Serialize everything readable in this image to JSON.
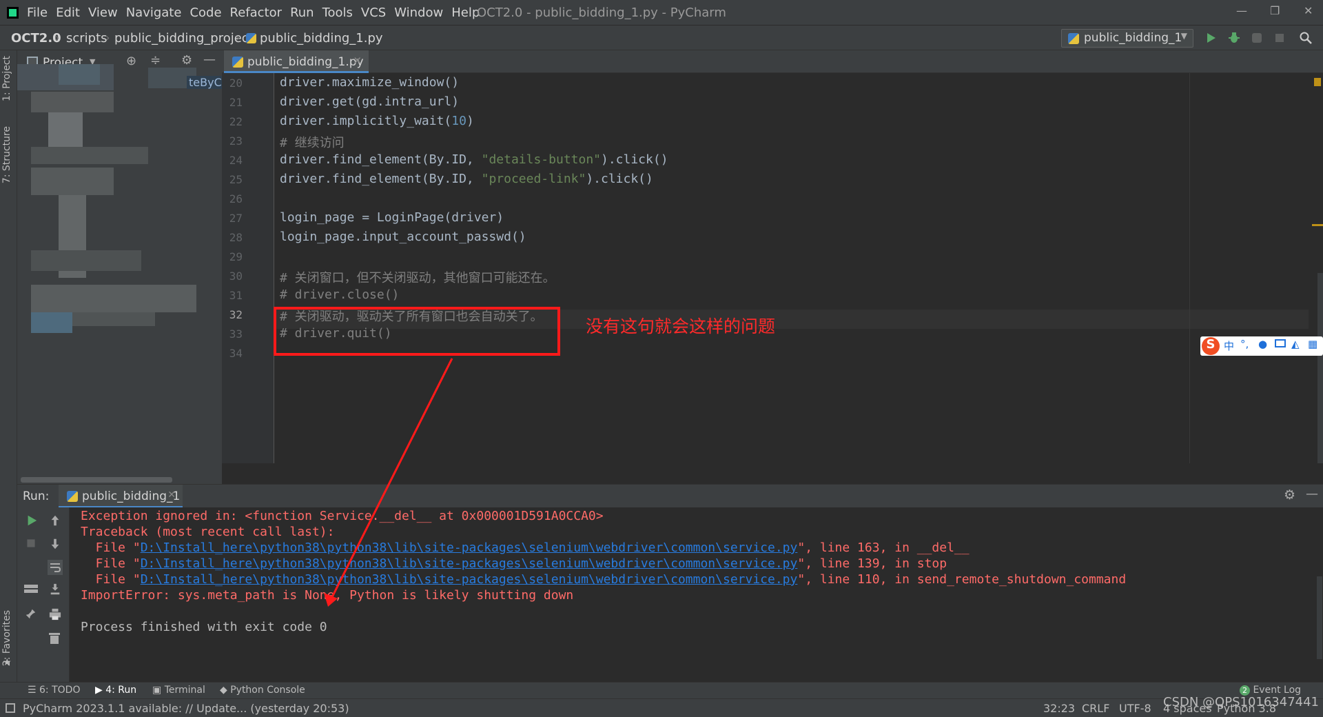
{
  "menu": {
    "items": [
      "File",
      "Edit",
      "View",
      "Navigate",
      "Code",
      "Refactor",
      "Run",
      "Tools",
      "VCS",
      "Window",
      "Help"
    ],
    "window_title": "OCT2.0 - public_bidding_1.py - PyCharm"
  },
  "nav": {
    "breadcrumbs": [
      "OCT2.0",
      "scripts",
      "public_bidding_project",
      "public_bidding_1.py"
    ],
    "run_config": "public_bidding_1"
  },
  "sidebar": {
    "project_label": "Project",
    "structure_label": "7: Structure",
    "project_tab_label": "1: Project",
    "favorites_label": "2: Favorites",
    "partial_text": "teByCl"
  },
  "editor": {
    "tab_label": "public_bidding_1.py",
    "current_line": 32,
    "lines": [
      {
        "n": "20",
        "text": "driver.maximize_window()"
      },
      {
        "n": "21",
        "text": "driver.get(gd.intra_url)"
      },
      {
        "n": "22",
        "pre": "driver.implicitly_wait(",
        "num": "10",
        "post": ")"
      },
      {
        "n": "23",
        "comment": "# 继续访问"
      },
      {
        "n": "24",
        "pre": "driver.find_element(By.ID, ",
        "str": "\"details-button\"",
        "post": ").click()"
      },
      {
        "n": "25",
        "pre": "driver.find_element(By.ID, ",
        "str": "\"proceed-link\"",
        "post": ").click()"
      },
      {
        "n": "26",
        "text": ""
      },
      {
        "n": "27",
        "text": "login_page = LoginPage(driver)"
      },
      {
        "n": "28",
        "text": "login_page.input_account_passwd()"
      },
      {
        "n": "29",
        "text": ""
      },
      {
        "n": "30",
        "comment": "# 关闭窗口，但不关闭驱动，其他窗口可能还在。"
      },
      {
        "n": "31",
        "comment": "# driver.close()"
      },
      {
        "n": "32",
        "comment": "# 关闭驱动，驱动关了所有窗口也会自动关了。"
      },
      {
        "n": "33",
        "comment": "# driver.quit()"
      },
      {
        "n": "34",
        "text": ""
      }
    ]
  },
  "annotation": {
    "note": "没有这句就会这样的问题",
    "color": "#ff1a1a"
  },
  "ime": {
    "logo": "S",
    "mode": "中"
  },
  "run": {
    "label": "Run:",
    "tab_label": "public_bidding_1",
    "output": {
      "l1": "Exception ignored in: <function Service.__del__ at 0x000001D591A0CCA0>",
      "l2": "Traceback (most recent call last):",
      "f_prefix": "  File \"",
      "path": "D:\\Install_here\\python38\\python38\\lib\\site-packages\\selenium\\webdriver\\common\\service.py",
      "f1_suffix": "\", line 163, in __del__",
      "f2_suffix": "\", line 139, in stop",
      "f3_suffix": "\", line 110, in send_remote_shutdown_command",
      "l6": "ImportError: sys.meta_path is None, Python is likely shutting down",
      "l8": "Process finished with exit code 0"
    }
  },
  "bottom_tabs": {
    "todo": "6: TODO",
    "run": "4: Run",
    "terminal": "Terminal",
    "python_console": "Python Console",
    "event_log": "Event Log",
    "event_log_count": "2"
  },
  "status": {
    "message": "PyCharm 2023.1.1 available: // Update... (yesterday 20:53)",
    "position": "32:23",
    "line_sep": "CRLF",
    "encoding": "UTF-8",
    "indent": "4 spaces",
    "interpreter": "Python 3.8"
  },
  "watermark": "CSDN @QPS1016347441"
}
